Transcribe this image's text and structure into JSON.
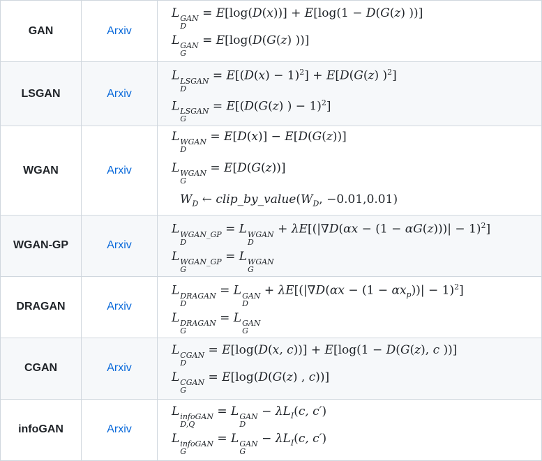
{
  "link_label": "Arxiv",
  "rows": [
    {
      "name": "GAN"
    },
    {
      "name": "LSGAN"
    },
    {
      "name": "WGAN"
    },
    {
      "name": "WGAN-GP"
    },
    {
      "name": "DRAGAN"
    },
    {
      "name": "CGAN"
    },
    {
      "name": "infoGAN"
    }
  ]
}
